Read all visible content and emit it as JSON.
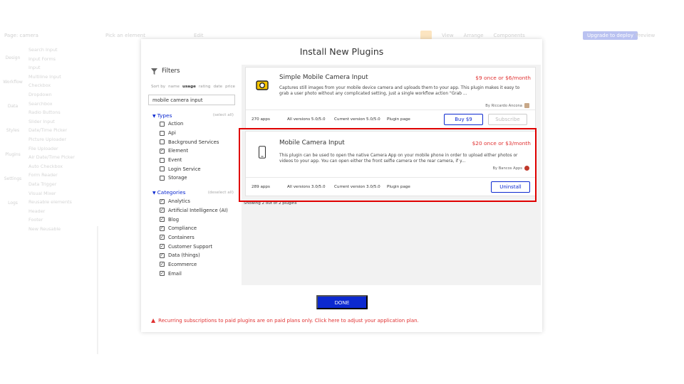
{
  "background": {
    "topbar": {
      "page_label": "Page: camera",
      "pick_label": "Pick an element",
      "edit_label": "Edit",
      "view_label": "View",
      "arrange_label": "Arrange",
      "components_label": "Components",
      "upgrade_label": "Upgrade to deploy",
      "preview_label": "Preview"
    },
    "leftnav": [
      "Design",
      "Workflow",
      "Data",
      "Styles",
      "Plugins",
      "Settings",
      "Logs"
    ],
    "elements": [
      "Search Input",
      "Input Forms",
      "Input",
      "Multiline Input",
      "Checkbox",
      "Dropdown",
      "Searchbox",
      "Radio Buttons",
      "Slider Input",
      "Date/Time Picker",
      "Picture Uploader",
      "File Uploader",
      "Air Date/Time Picker",
      "Auto Checkbox",
      "Form Reader",
      "Data Trigger",
      "Visual Mixer",
      "Reusable elements",
      "Header",
      "Footer",
      "New Reusable"
    ]
  },
  "modal": {
    "title": "Install New Plugins",
    "filters": {
      "heading": "Filters",
      "sort_by": "Sort by",
      "sort_options": [
        "name",
        "usage",
        "rating",
        "date",
        "price"
      ],
      "active_sort": "usage",
      "search_value": "mobile camera input",
      "types": {
        "heading": "Types",
        "select_all": "(select all)",
        "options": [
          {
            "label": "Action",
            "checked": false
          },
          {
            "label": "Api",
            "checked": false
          },
          {
            "label": "Background Services",
            "checked": false
          },
          {
            "label": "Element",
            "checked": true
          },
          {
            "label": "Event",
            "checked": false
          },
          {
            "label": "Login Service",
            "checked": false
          },
          {
            "label": "Storage",
            "checked": false
          }
        ]
      },
      "categories": {
        "heading": "Categories",
        "deselect_all": "(deselect all)",
        "options": [
          {
            "label": "Analytics",
            "checked": true
          },
          {
            "label": "Artificial Intelligence (AI)",
            "checked": true
          },
          {
            "label": "Blog",
            "checked": true
          },
          {
            "label": "Compliance",
            "checked": true
          },
          {
            "label": "Containers",
            "checked": true
          },
          {
            "label": "Customer Support",
            "checked": true
          },
          {
            "label": "Data (things)",
            "checked": true
          },
          {
            "label": "Ecommerce",
            "checked": true
          },
          {
            "label": "Email",
            "checked": true
          }
        ]
      }
    },
    "plugins": [
      {
        "name": "Simple Mobile Camera Input",
        "price": "$9 once or $6/month",
        "description": "Captures still images from your mobile device camera and uploads them to your app. This plugin makes it easy to grab a user photo without any complicated setting, just a single workflow action \"Grab ...",
        "author": "By Riccardo Ancona",
        "apps": "270 apps",
        "all_versions": "All versions 5.0/5.0",
        "current_version": "Current version 5.0/5.0",
        "plugin_page": "Plugin page",
        "buy_label": "Buy $9",
        "subscribe_label": "Subscribe",
        "icon_color": "#f5c400"
      },
      {
        "name": "Mobile Camera Input",
        "price": "$20 once or $3/month",
        "description": "This plugin can be used to open the native Camera App on your mobile phone in order to upload either photos or videos to your app. You can open either the front selfie camera or the rear camera, if y...",
        "author": "By Bancos Apps",
        "apps": "289 apps",
        "all_versions": "All versions 3.0/5.0",
        "current_version": "Current version 3.0/5.0",
        "plugin_page": "Plugin page",
        "uninstall_label": "Uninstall"
      }
    ],
    "showing": "Showing 2 out of 2 plugins",
    "done_label": "DONE",
    "notice": "Recurring subscriptions to paid plugins are on paid plans only. Click here to adjust your application plan."
  },
  "colors": {
    "accent": "#0c29d0",
    "price": "#e03030",
    "highlight": "#e00000"
  }
}
